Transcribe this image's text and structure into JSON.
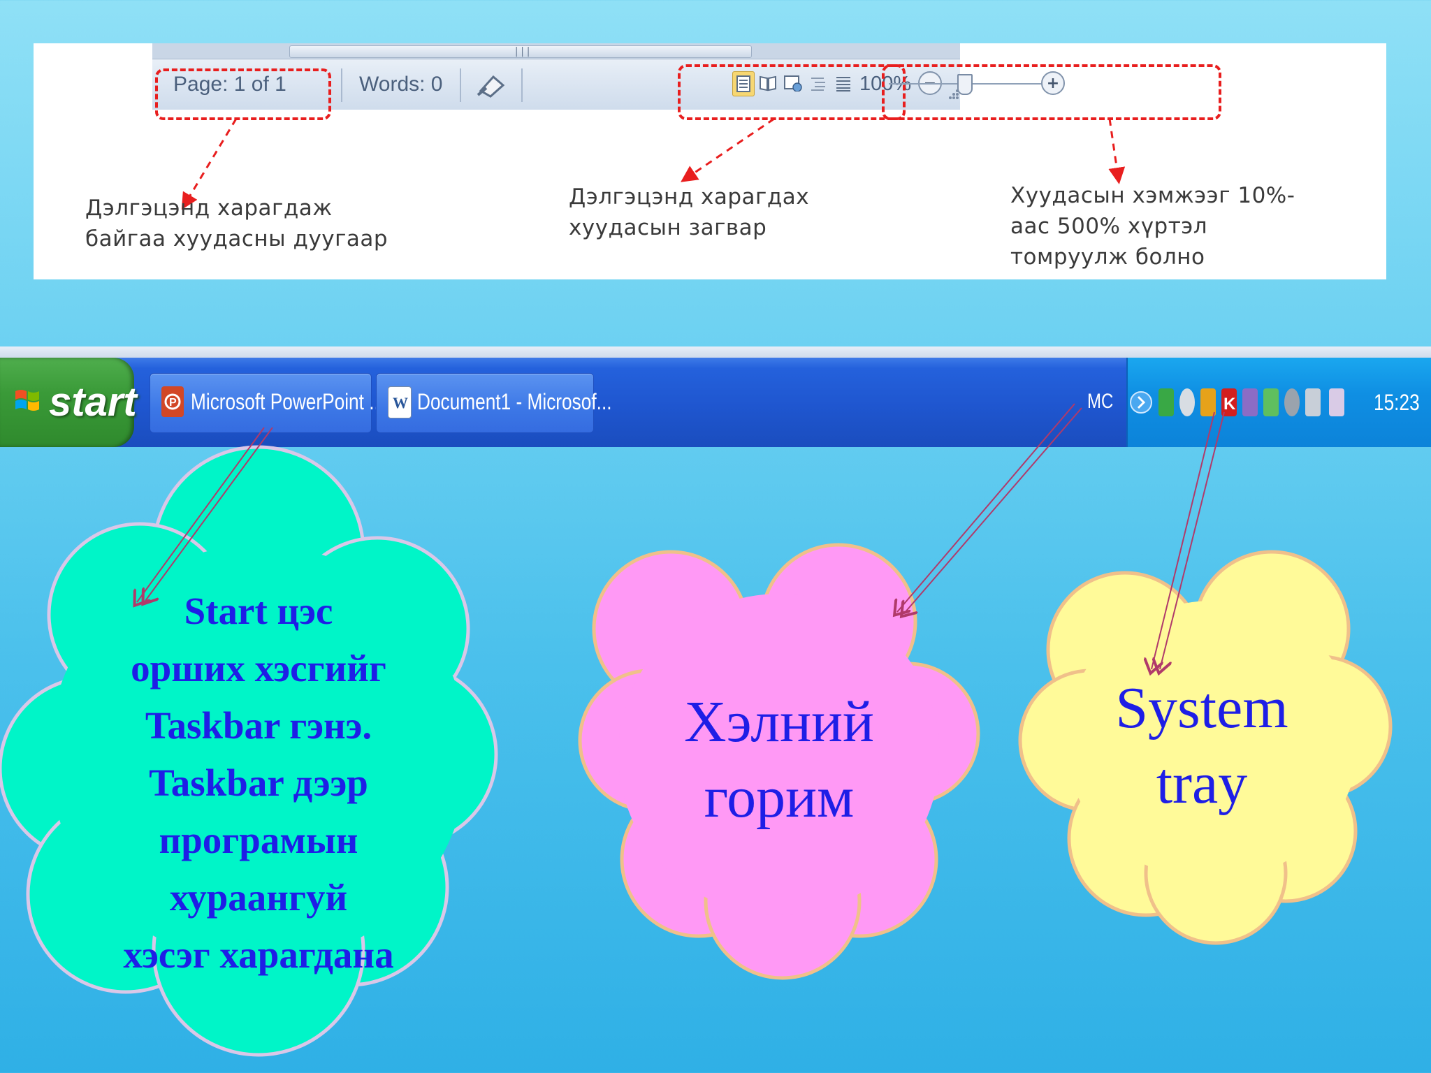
{
  "status_bar": {
    "page_indicator": "Page: 1 of 1",
    "words_count": "Words: 0",
    "view_buttons": [
      "print-layout",
      "full-screen-reading",
      "web-layout",
      "outline",
      "draft"
    ],
    "zoom_level": "100%",
    "zoom_out_symbol": "−",
    "zoom_in_symbol": "+",
    "scroll_grip": "|||"
  },
  "callouts": {
    "page_number": "Дэлгэцэнд  харагдаж\nбайгаа хуудасны  дуугаар",
    "page_layout": "Дэлгэцэнд харагдах\nхуудасын загвар",
    "zoom": "Хуудасын хэмжээг  10%-\nаас 500% хүртэл\nтомруулж болно"
  },
  "taskbar": {
    "start_label": "start",
    "tasks": [
      {
        "label": "Microsoft PowerPoint ...",
        "icon": "powerpoint-icon"
      },
      {
        "label": "Document1 - Microsof...",
        "icon": "word-icon"
      }
    ],
    "language": "MC",
    "clock": "15:23"
  },
  "clouds": {
    "taskbar_note": "Start цэс\nорших хэсгийг\nTaskbar  гэнэ.\nTaskbar  дээр\nпрограмын\nхураангуй\nхэсэг харагдана",
    "language_mode": "Хэлний\nгорим",
    "system_tray": "System\ntray"
  },
  "colors": {
    "dash_red": "#e81e1e",
    "cloud_green": "#00f5c8",
    "cloud_pink": "#ff99f5",
    "cloud_yellow": "#fffa99",
    "cloud_text_blue": "#1e1ee6",
    "taskbar_blue": "#2461dc",
    "start_green": "#3a9a38"
  }
}
